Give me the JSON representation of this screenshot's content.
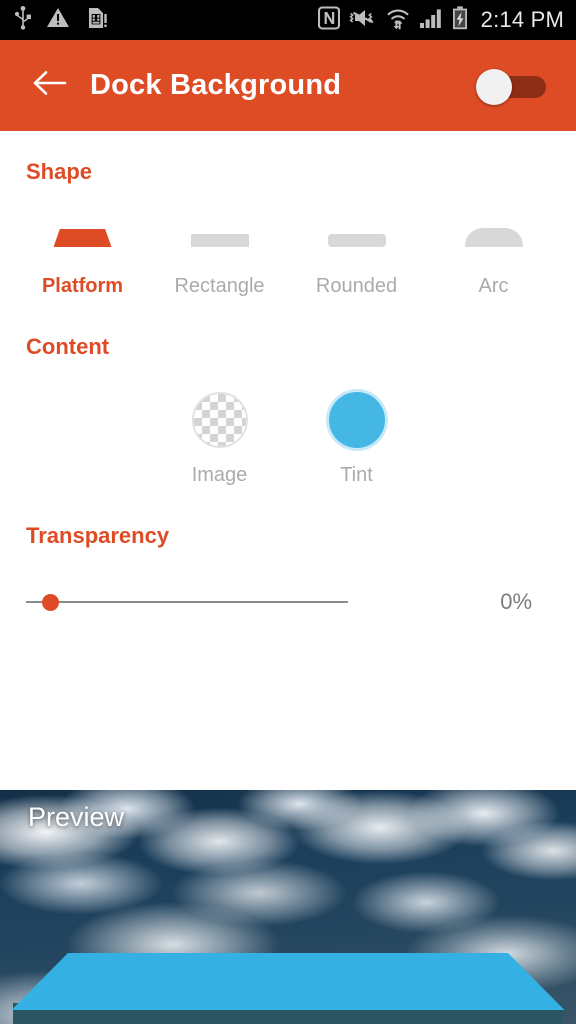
{
  "status_bar": {
    "left_icons": [
      "usb-icon",
      "warning-triangle-icon",
      "sim-card-alert-icon"
    ],
    "right_icons": [
      "nfc-icon",
      "volume-vibrate-mute-icon",
      "wifi-icon",
      "cellular-signal-icon",
      "battery-charging-icon"
    ],
    "clock": "2:14 PM",
    "background_color": "#000000",
    "icon_color": "#BFBFBF"
  },
  "app_bar": {
    "back_icon": "arrow-left-icon",
    "title": "Dock Background",
    "accent_color": "#DE4C26",
    "toggle": {
      "name": "dock-background-toggle",
      "state": "off",
      "track_color": "#8E2E17",
      "thumb_color": "#F1F1F1"
    }
  },
  "sections": {
    "shape": {
      "title": "Shape",
      "selected": "Platform",
      "options": [
        {
          "label": "Platform",
          "glyph": "trapezoid-shape-icon",
          "selected": true
        },
        {
          "label": "Rectangle",
          "glyph": "rectangle-shape-icon",
          "selected": false
        },
        {
          "label": "Rounded",
          "glyph": "rounded-rect-shape-icon",
          "selected": false
        },
        {
          "label": "Arc",
          "glyph": "arc-shape-icon",
          "selected": false
        }
      ]
    },
    "content": {
      "title": "Content",
      "selected": "Tint",
      "options": [
        {
          "label": "Image",
          "glyph": "checkerboard-circle-icon",
          "selected": false
        },
        {
          "label": "Tint",
          "glyph": "tint-color-circle-icon",
          "selected": true,
          "color": "#45B7E4"
        }
      ]
    },
    "transparency": {
      "title": "Transparency",
      "value": 0,
      "value_label": "0%",
      "min": 0,
      "max": 100,
      "thumb_color": "#DE4C26",
      "track_color": "#8C8C8C"
    }
  },
  "preview": {
    "label": "Preview",
    "wallpaper": "clouds-aerial-photo",
    "dock": {
      "shape": "platform-trapezoid",
      "tint_color": "#35B0E2",
      "edge_color": "#2C5564"
    }
  }
}
